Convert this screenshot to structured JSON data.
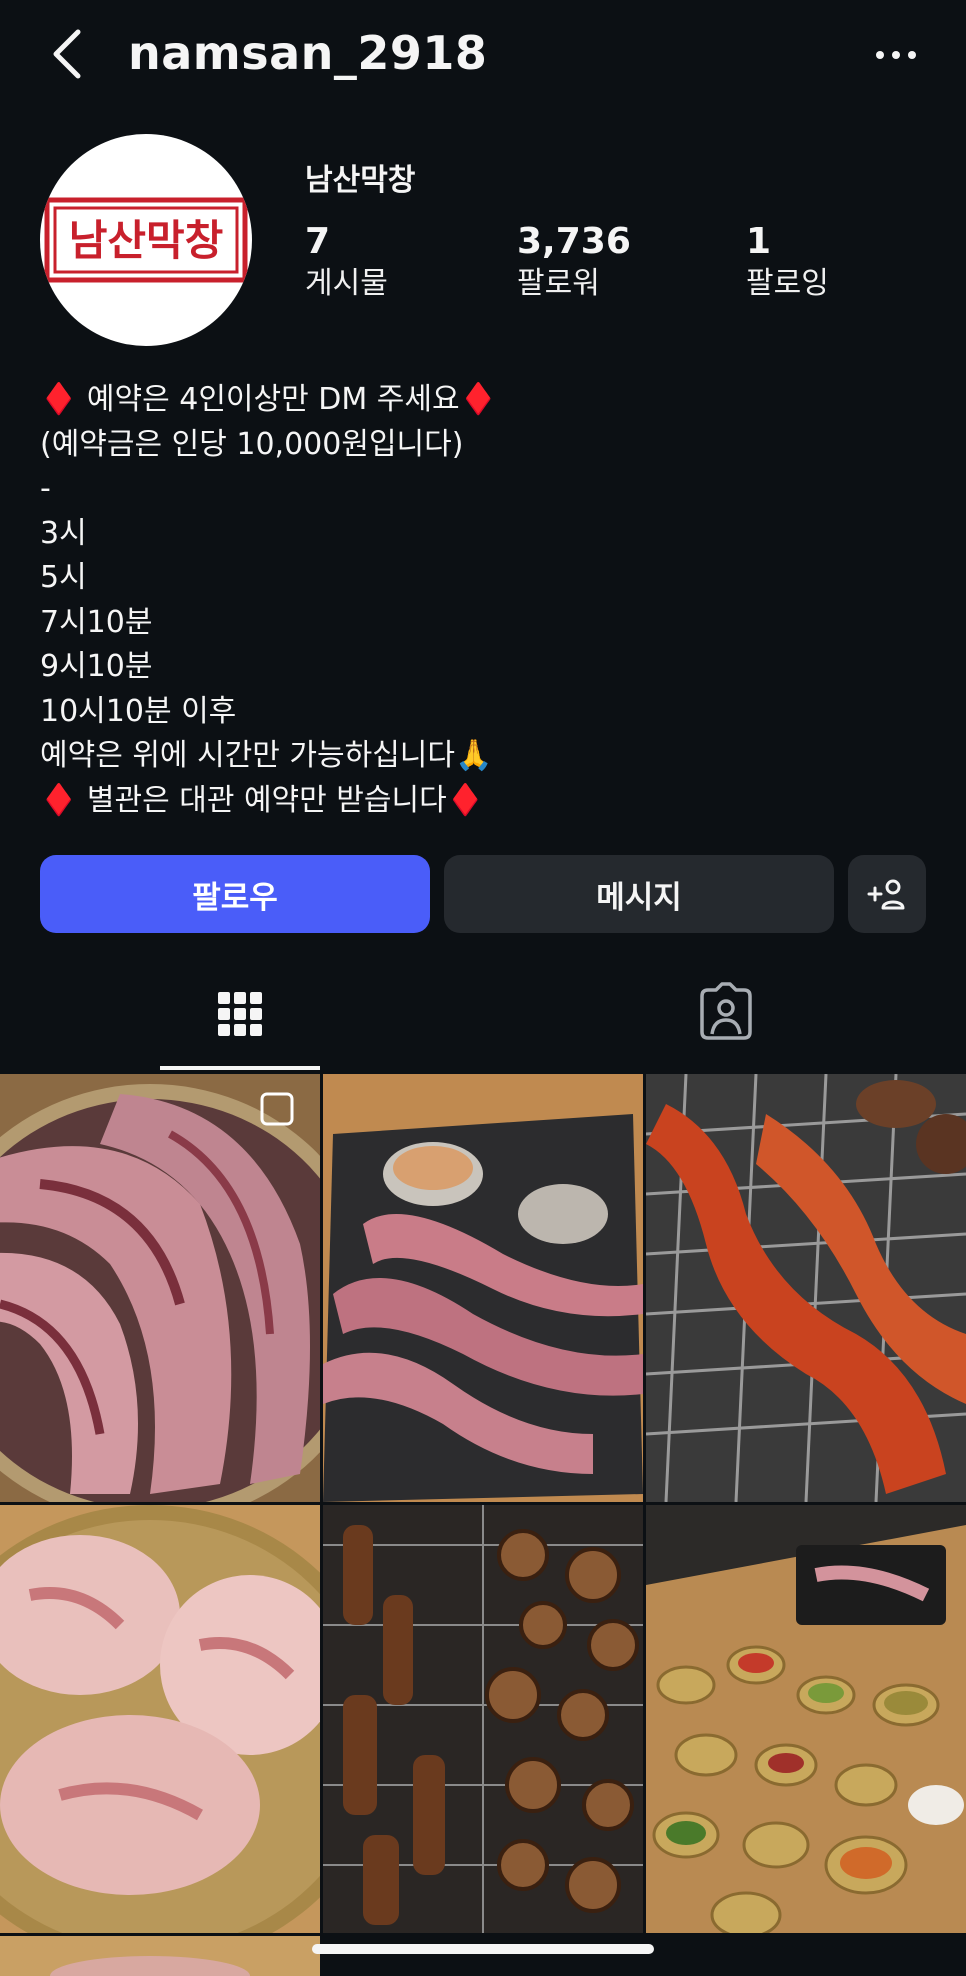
{
  "header": {
    "username": "namsan_2918"
  },
  "profile": {
    "display_name": "남산막창",
    "logo_text": "남산막창",
    "stats": [
      {
        "value": "7",
        "label": "게시물"
      },
      {
        "value": "3,736",
        "label": "팔로워"
      },
      {
        "value": "1",
        "label": "팔로잉"
      }
    ]
  },
  "bio": "♦️ 예약은 4인이상만 DM 주세요♦️\n(예약금은 인당 10,000원입니다)\n-\n3시\n5시\n7시10분\n9시10분\n10시10분 이후\n예약은 위에 시간만 가능하십니다🙏\n♦️ 별관은 대관 예약만 받습니다♦️",
  "actions": {
    "follow": "팔로우",
    "message": "메시지"
  },
  "tabs": [
    {
      "icon": "grid-icon",
      "active": true
    },
    {
      "icon": "tagged-person-icon",
      "active": false
    }
  ],
  "colors": {
    "background": "#0c1014",
    "follow": "#4a5df9",
    "secondary_button": "#25292e",
    "logo_red": "#c8202c"
  },
  "posts": [
    {
      "name": "raw-marbled-meat-platter",
      "multi": true
    },
    {
      "name": "meat-strips-on-grill",
      "multi": false
    },
    {
      "name": "spicy-makchang-on-grill",
      "multi": false
    },
    {
      "name": "pork-slices-on-plate",
      "multi": false
    },
    {
      "name": "grilled-intestines",
      "multi": false
    },
    {
      "name": "table-spread-side-dishes",
      "multi": false
    }
  ]
}
